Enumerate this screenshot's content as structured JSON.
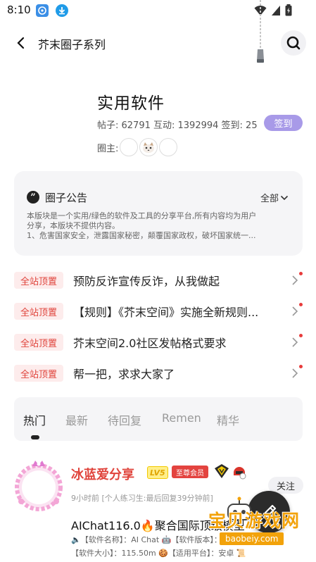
{
  "status_bar": {
    "time": "8:10"
  },
  "header": {
    "title": "芥末圈子系列"
  },
  "circle": {
    "name": "实用软件",
    "stats": "帖子: 62791 互动: 1392994 签到: 25",
    "signin_label": "签到",
    "owners_label": "圈主:"
  },
  "notice": {
    "title": "圈子公告",
    "all_label": "全部",
    "lines": [
      "本版块是一个实用/绿色的软件及工具的分享平台,所有内容均为用户",
      "分享，本版块不提供内容。",
      "1、危害国家安全，泄露国家秘密，颠覆国家政权，破坏国家统一..."
    ]
  },
  "pinned": [
    {
      "tag": "全站顶置",
      "text": "预防反诈宣传反诈，从我做起"
    },
    {
      "tag": "全站顶置",
      "text": "【规则】《芥末空间》实施全新规则..."
    },
    {
      "tag": "全站顶置",
      "text": "芥末空间2.0社区发帖格式要求"
    },
    {
      "tag": "全站顶置",
      "text": "帮一把，求求大家了"
    }
  ],
  "tabs": [
    {
      "label": "热门",
      "active": true
    },
    {
      "label": "最新",
      "active": false
    },
    {
      "label": "待回复",
      "active": false
    },
    {
      "label": "Remen",
      "active": false
    },
    {
      "label": "精华",
      "active": false
    }
  ],
  "post": {
    "username": "冰蓝爱分享",
    "level": "LV5",
    "vip_label": "至尊会员",
    "follow_label": "关注",
    "meta": "9小时前 [个人练习生:最后回复39分钟前]",
    "title": "AIChat116.0🔥聚合国际顶级模型",
    "info_line1": "🔈【软件名称】：AI Chat 🤖【软件版本】：116.0 ⚖",
    "info_line2": "【软件大小】：115.50m 🍪【适用平台】：安卓 📜"
  },
  "watermark": {
    "text": "宝贝游戏网",
    "url": "baobeiy.com"
  },
  "colors": {
    "accent_purple": "#a89ae8",
    "pinned_red": "#e0443c",
    "pinned_bg": "#fdecec",
    "card_bg": "#f5f5f7"
  }
}
